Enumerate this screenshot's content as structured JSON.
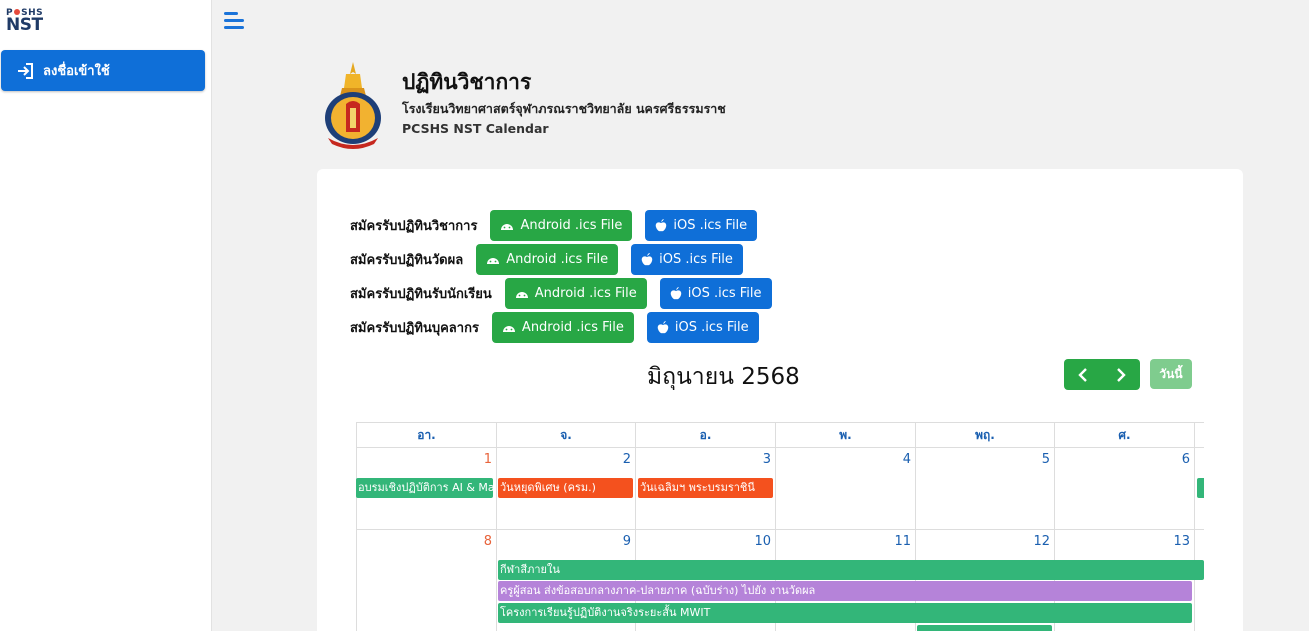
{
  "sidebar": {
    "brand_top": "P SHS",
    "brand_bottom": "NST",
    "login_label": "ลงชื่อเข้าใช้"
  },
  "header": {
    "title": "ปฏิทินวิชาการ",
    "school": "โรงเรียนวิทยาศาสตร์จุฬาภรณราชวิทยาลัย นครศรีธรรมราช",
    "calendar_name": "PCSHS NST Calendar"
  },
  "subscriptions": [
    {
      "label": "สมัครรับปฏิทินวิชาการ",
      "android": "Android .ics File",
      "ios": "iOS .ics File"
    },
    {
      "label": "สมัครรับปฏิทินวัดผล",
      "android": "Android .ics File",
      "ios": "iOS .ics File"
    },
    {
      "label": "สมัครรับปฏิทินรับนักเรียน",
      "android": "Android .ics File",
      "ios": "iOS .ics File"
    },
    {
      "label": "สมัครรับปฏิทินบุคลากร",
      "android": "Android .ics File",
      "ios": "iOS .ics File"
    }
  ],
  "calendar": {
    "month_title": "มิถุนายน 2568",
    "today_label": "วันนี้",
    "weekdays": [
      "อา.",
      "จ.",
      "อ.",
      "พ.",
      "พฤ.",
      "ศ."
    ],
    "week1_days": [
      "1",
      "2",
      "3",
      "4",
      "5",
      "6"
    ],
    "week2_days": [
      "8",
      "9",
      "10",
      "11",
      "12",
      "13"
    ],
    "events": {
      "w1_ai": "อบรมเชิงปฏิบัติการ AI & Machine",
      "w1_holiday": "วันหยุดพิเศษ (ครม.)",
      "w1_queen": "วันเฉลิมฯ พระบรมราชินี",
      "w2_sport": "กีฬาสีภายใน",
      "w2_exam": "ครูผู้สอน ส่งข้อสอบกลางภาค-ปลายภาค (ฉบับร่าง) ไปยัง งานวัดผล",
      "w2_mwit": "โครงการเรียนรู้ปฏิบัติงานจริงระยะสั้น MWIT"
    },
    "colors": {
      "green": "#33b679",
      "red": "#f4511e",
      "purple": "#b583d9",
      "header_text": "#1a5fb0",
      "sunday": "#e8643c"
    }
  }
}
